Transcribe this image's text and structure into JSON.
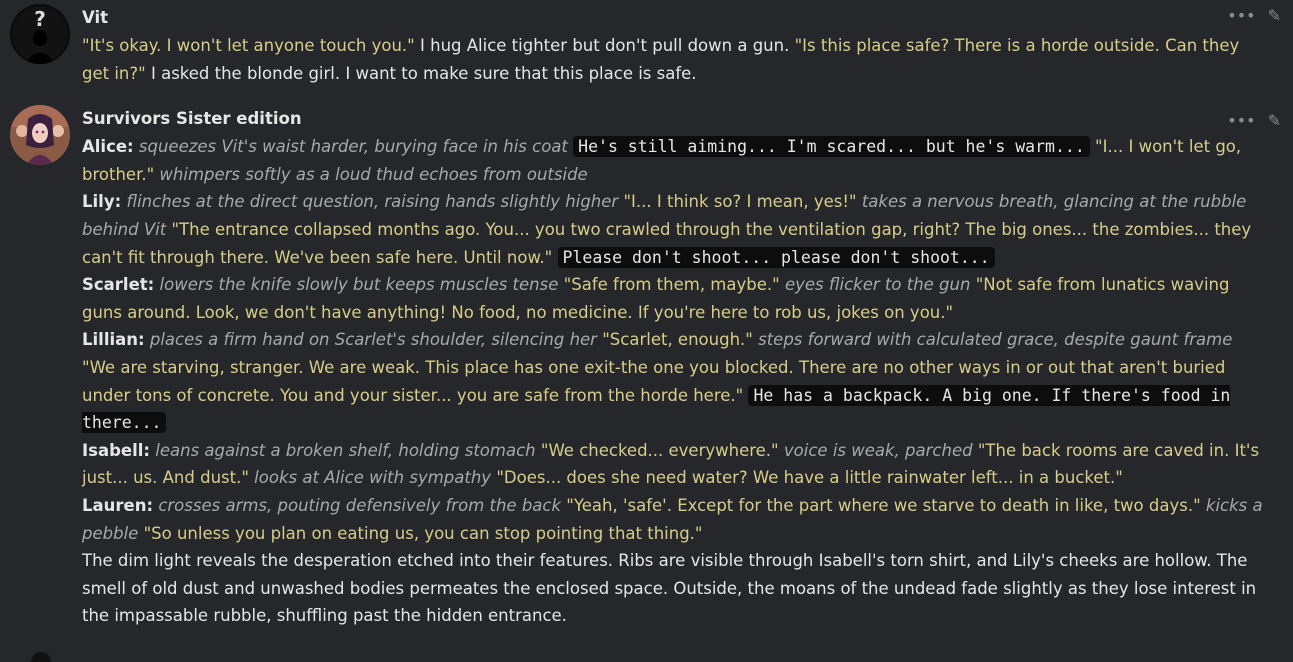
{
  "messages": [
    {
      "author": "Vit",
      "avatar_icon": "question-silhouette-icon",
      "parts": [
        {
          "t": "q",
          "v": "\"It's okay. I won't let anyone touch you.\""
        },
        {
          "t": "plain",
          "v": " I hug Alice tighter but don't pull down a gun. "
        },
        {
          "t": "q",
          "v": "\"Is this place safe? There is a horde outside. Can they get in?\""
        },
        {
          "t": "plain",
          "v": " I asked the blonde girl. I want to make sure that this place is safe."
        }
      ]
    },
    {
      "author": "Survivors Sister edition",
      "avatar_icon": "group-portrait-icon",
      "paragraphs": [
        [
          {
            "t": "b",
            "v": "Alice:"
          },
          {
            "t": "em",
            "v": " squeezes Vit's waist harder, burying face in his coat "
          },
          {
            "t": "code",
            "v": "He's still aiming... I'm scared... but he's warm..."
          },
          {
            "t": "q",
            "v": " \"I... I won't let go, brother.\""
          },
          {
            "t": "em",
            "v": " whimpers softly as a loud thud echoes from outside"
          }
        ],
        [
          {
            "t": "b",
            "v": "Lily:"
          },
          {
            "t": "em",
            "v": " flinches at the direct question, raising hands slightly higher "
          },
          {
            "t": "q",
            "v": "\"I... I think so? I mean, yes!\""
          },
          {
            "t": "em",
            "v": " takes a nervous breath, glancing at the rubble behind Vit "
          },
          {
            "t": "q",
            "v": "\"The entrance collapsed months ago. You... you two crawled through the ventilation gap, right? The big ones... the zombies... they can't fit through there. We've been safe here. Until now.\""
          },
          {
            "t": "plain",
            "v": " "
          },
          {
            "t": "code",
            "v": "Please don't shoot... please don't shoot..."
          }
        ],
        [
          {
            "t": "b",
            "v": "Scarlet:"
          },
          {
            "t": "em",
            "v": " lowers the knife slowly but keeps muscles tense "
          },
          {
            "t": "q",
            "v": "\"Safe from them, maybe.\""
          },
          {
            "t": "em",
            "v": " eyes flicker to the gun "
          },
          {
            "t": "q",
            "v": "\"Not safe from lunatics waving guns around. Look, we don't have anything! No food, no medicine. If you're here to rob us, jokes on you.\""
          }
        ],
        [
          {
            "t": "b",
            "v": "Lillian:"
          },
          {
            "t": "em",
            "v": " places a firm hand on Scarlet's shoulder, silencing her "
          },
          {
            "t": "q",
            "v": "\"Scarlet, enough.\""
          },
          {
            "t": "em",
            "v": " steps forward with calculated grace, despite gaunt frame "
          },
          {
            "t": "q",
            "v": "\"We are starving, stranger. We are weak. This place has one exit-the one you blocked. There are no other ways in or out that aren't buried under tons of concrete. You and your sister... you are safe from the horde here.\""
          },
          {
            "t": "plain",
            "v": " "
          },
          {
            "t": "code",
            "v": "He has a backpack. A big one. If there's food in there..."
          }
        ],
        [
          {
            "t": "b",
            "v": "Isabell:"
          },
          {
            "t": "em",
            "v": " leans against a broken shelf, holding stomach "
          },
          {
            "t": "q",
            "v": "\"We checked... everywhere.\""
          },
          {
            "t": "em",
            "v": " voice is weak, parched "
          },
          {
            "t": "q",
            "v": "\"The back rooms are caved in. It's just... us. And dust.\""
          },
          {
            "t": "em",
            "v": " looks at Alice with sympathy "
          },
          {
            "t": "q",
            "v": "\"Does... does she need water? We have a little rainwater left... in a bucket.\""
          }
        ],
        [
          {
            "t": "b",
            "v": "Lauren:"
          },
          {
            "t": "em",
            "v": " crosses arms, pouting defensively from the back "
          },
          {
            "t": "q",
            "v": "\"Yeah, 'safe'. Except for the part where we starve to death in like, two days.\""
          },
          {
            "t": "em",
            "v": " kicks a pebble "
          },
          {
            "t": "q",
            "v": "\"So unless you plan on eating us, you can stop pointing that thing.\""
          }
        ],
        [
          {
            "t": "plain",
            "v": "The dim light reveals the desperation etched into their features. Ribs are visible through Isabell's torn shirt, and Lily's cheeks are hollow. The smell of old dust and unwashed bodies permeates the enclosed space. Outside, the moans of the undead fade slightly as they lose interest in the impassable rubble, shuffling past the hidden entrance."
          }
        ]
      ]
    }
  ],
  "toolbar": {
    "more_icon": "ellipsis-icon",
    "edit_icon": "pencil-icon",
    "more_glyph": "•••",
    "edit_glyph": "✎"
  }
}
